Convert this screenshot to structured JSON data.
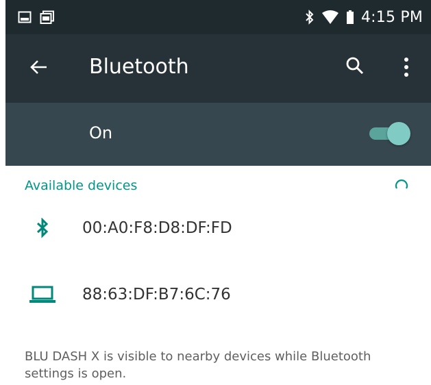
{
  "status_bar": {
    "left_icons": [
      "image-notification-icon",
      "photo-notification-icon"
    ],
    "right_icons": [
      "bluetooth-status-icon",
      "wifi-icon",
      "battery-icon"
    ],
    "time": "4:15 PM"
  },
  "app_bar": {
    "title": "Bluetooth",
    "back_icon": "back-arrow-icon",
    "search_icon": "search-icon",
    "more_icon": "more-vert-icon"
  },
  "master_switch": {
    "label": "On",
    "state": "on"
  },
  "available_devices": {
    "header": "Available devices",
    "scanning": true,
    "devices": [
      {
        "name": "00:A0:F8:D8:DF:FD",
        "icon": "bluetooth-icon"
      },
      {
        "name": "88:63:DF:B7:6C:76",
        "icon": "laptop-icon"
      }
    ]
  },
  "footer": {
    "note": "BLU DASH X is visible to nearby devices while Bluetooth settings is open."
  },
  "colors": {
    "status_bar": "#1f2a2e",
    "app_bar": "#263238",
    "switch_bar": "#37474f",
    "accent": "#009688",
    "toggle_thumb": "#80cbc4"
  }
}
